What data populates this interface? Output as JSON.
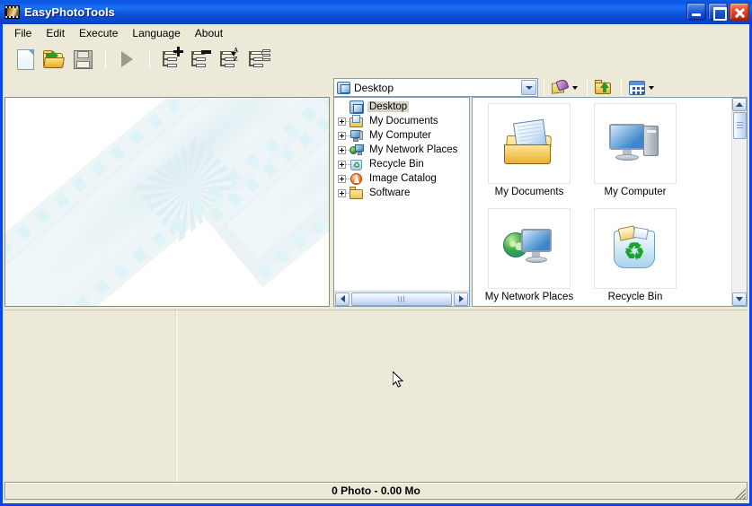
{
  "window": {
    "title": "EasyPhotoTools",
    "icon": "filmstrip-icon",
    "buttons": {
      "minimize": "minimize",
      "maximize": "maximize",
      "close": "close"
    }
  },
  "menubar": {
    "items": [
      {
        "label": "File"
      },
      {
        "label": "Edit"
      },
      {
        "label": "Execute"
      },
      {
        "label": "Language"
      },
      {
        "label": "About"
      }
    ]
  },
  "toolbar": {
    "buttons": [
      {
        "name": "new-document",
        "icon": "new-document-icon",
        "enabled": true
      },
      {
        "name": "open-folder",
        "icon": "open-folder-icon",
        "enabled": true
      },
      {
        "name": "save",
        "icon": "save-disk-icon",
        "enabled": false
      },
      {
        "name": "execute",
        "icon": "play-icon",
        "enabled": false
      },
      {
        "name": "add-to-list",
        "icon": "list-add-icon",
        "enabled": true
      },
      {
        "name": "remove-from-list",
        "icon": "list-remove-icon",
        "enabled": true
      },
      {
        "name": "sort-list",
        "icon": "list-sort-az-icon",
        "enabled": true
      },
      {
        "name": "edit-list",
        "icon": "list-edit-icon",
        "enabled": true
      }
    ]
  },
  "browser": {
    "address": {
      "value": "Desktop",
      "icon": "desktop-icon",
      "dropdown": "chevron-down-icon"
    },
    "tools": [
      {
        "name": "organize",
        "icon": "organize-icon",
        "has_dropdown": true
      },
      {
        "name": "up-one-level",
        "icon": "up-folder-icon",
        "has_dropdown": false
      },
      {
        "name": "views",
        "icon": "views-icon",
        "has_dropdown": true
      }
    ],
    "tree": {
      "items": [
        {
          "label": "Desktop",
          "icon": "desktop-icon",
          "indent": 0,
          "expandable": false,
          "selected": true
        },
        {
          "label": "My Documents",
          "icon": "my-documents-icon",
          "indent": 1,
          "expandable": true,
          "selected": false
        },
        {
          "label": "My Computer",
          "icon": "my-computer-icon",
          "indent": 1,
          "expandable": true,
          "selected": false
        },
        {
          "label": "My Network Places",
          "icon": "network-places-icon",
          "indent": 1,
          "expandable": true,
          "selected": false
        },
        {
          "label": "Recycle Bin",
          "icon": "recycle-bin-icon",
          "indent": 1,
          "expandable": true,
          "selected": false
        },
        {
          "label": "Image Catalog",
          "icon": "image-catalog-icon",
          "indent": 1,
          "expandable": true,
          "selected": false
        },
        {
          "label": "Software",
          "icon": "folder-icon",
          "indent": 1,
          "expandable": true,
          "selected": false
        }
      ],
      "hscroll": {
        "left_arrow": "left-arrow-icon",
        "right_arrow": "right-arrow-icon"
      }
    },
    "list": {
      "items": [
        {
          "label": "My Documents",
          "icon": "my-documents-icon"
        },
        {
          "label": "My Computer",
          "icon": "my-computer-icon"
        },
        {
          "label": "My Network Places",
          "icon": "network-places-icon"
        },
        {
          "label": "Recycle Bin",
          "icon": "recycle-bin-icon"
        }
      ],
      "vscroll": {
        "up_arrow": "up-arrow-icon",
        "down_arrow": "down-arrow-icon"
      }
    }
  },
  "preview": {
    "watermark": "filmstrip-watermark",
    "empty": true
  },
  "statusbar": {
    "text": "0 Photo - 0.00 Mo"
  },
  "colors": {
    "title_bar": "#0a46cf",
    "face": "#ece9d8",
    "pane": "#ffffff",
    "accent": "#316ac5",
    "close_button": "#e24a2a"
  }
}
